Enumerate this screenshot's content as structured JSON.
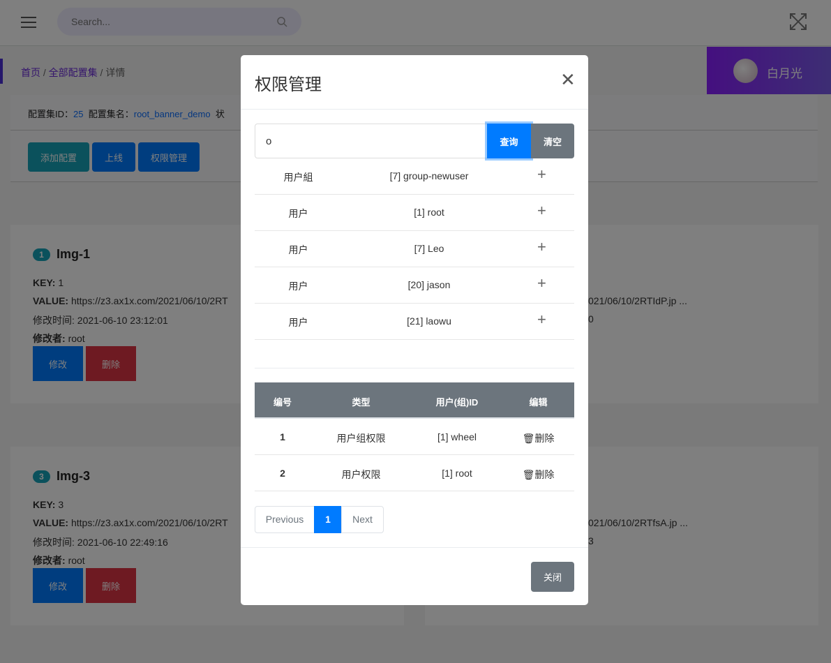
{
  "header": {
    "search_placeholder": "Search...",
    "icons": [
      "menu-icon",
      "search-icon",
      "fullscreen-icon"
    ]
  },
  "breadcrumb": {
    "home": "首页",
    "sep1": " / ",
    "all": "全部配置集",
    "sep2": " / ",
    "current": "详情"
  },
  "user": {
    "name": "白月光"
  },
  "info": {
    "id_label": "配置集ID：",
    "id_value": "25",
    "name_label": "配置集名：",
    "name_value": "root_banner_demo",
    "status_label": "状"
  },
  "toolbar": {
    "add": "添加配置",
    "online": "上线",
    "perm": "权限管理"
  },
  "cards": [
    {
      "badge": "1",
      "title": "Img-1",
      "key_label": "KEY:",
      "key": "1",
      "value_label": "VALUE:",
      "value": "https://z3.ax1x.com/2021/06/10/2RT",
      "time_label": "修改时间:",
      "time": "2021-06-10 23:12:01",
      "modifier_label": "修改者:",
      "modifier": "root",
      "edit": "修改",
      "delete": "删除"
    },
    {
      "badge": "3",
      "title": "Img-3",
      "key_label": "KEY:",
      "key": "3",
      "value_label": "VALUE:",
      "value": "https://z3.ax1x.com/2021/06/10/2RT",
      "time_label": "修改时间:",
      "time": "2021-06-10 22:49:16",
      "modifier_label": "修改者:",
      "modifier": "root",
      "edit": "修改",
      "delete": "删除"
    }
  ],
  "right_cards": [
    {
      "value_fragment": "021/06/10/2RTIdP.jp ...",
      "time_fragment": "0"
    },
    {
      "value_fragment": "021/06/10/2RTfsA.jp ...",
      "time_fragment": "3"
    }
  ],
  "modal": {
    "title": "权限管理",
    "search_value": "o",
    "query": "查询",
    "clear": "清空",
    "results": [
      {
        "type": "用户組",
        "name": "[7] group-newuser"
      },
      {
        "type": "用户",
        "name": "[1] root"
      },
      {
        "type": "用户",
        "name": "[7] Leo"
      },
      {
        "type": "用户",
        "name": "[20] jason"
      },
      {
        "type": "用户",
        "name": "[21] laowu"
      }
    ],
    "table": {
      "headers": [
        "编号",
        "类型",
        "用户(组)ID",
        "编辑"
      ],
      "rows": [
        {
          "no": "1",
          "type": "用户组权限",
          "id": "[1] wheel",
          "action": "删除"
        },
        {
          "no": "2",
          "type": "用户权限",
          "id": "[1] root",
          "action": "删除"
        }
      ]
    },
    "pagination": {
      "prev": "Previous",
      "page": "1",
      "next": "Next"
    },
    "close": "关闭"
  },
  "colors": {
    "primary": "#007bff",
    "secondary": "#6c757d",
    "danger": "#dc3545",
    "info": "#17a2b8",
    "user_bg": "#8a1fff"
  }
}
